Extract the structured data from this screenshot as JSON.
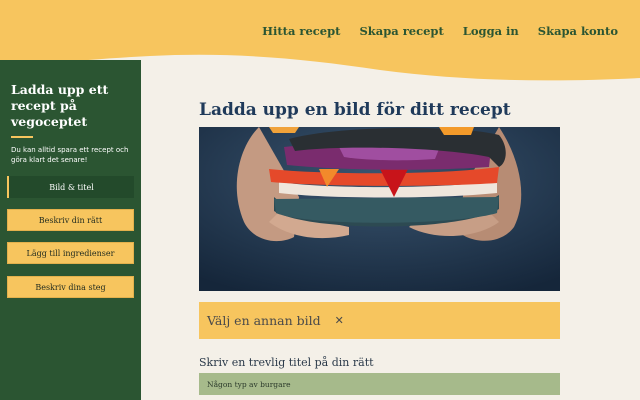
{
  "nav": {
    "find_recipe": "Hitta recept",
    "create_recipe": "Skapa recept",
    "login": "Logga in",
    "create_account": "Skapa konto"
  },
  "sidebar": {
    "title": "Ladda upp ett recept på vegoceptet",
    "note": "Du kan alltid spara ett recept och göra klart det senare!",
    "steps": [
      {
        "label": "Bild & titel",
        "state": "active"
      },
      {
        "label": "Beskriv din rätt",
        "state": "todo"
      },
      {
        "label": "Lägg till ingredienser",
        "state": "todo"
      },
      {
        "label": "Beskriv dina steg",
        "state": "todo"
      }
    ]
  },
  "main": {
    "title": "Ladda upp en bild för ditt recept",
    "change_image_label": "Välj en annan bild",
    "change_image_icon": "close-icon",
    "field_label": "Skriv en trevlig titel på din rätt",
    "title_placeholder": "Någon typ av burgare"
  },
  "colors": {
    "header_yellow": "#f7c55e",
    "sidebar_green": "#2b5532",
    "background": "#f4f0e8",
    "input_green": "#a6ba8b",
    "title_blue": "#1f3a5a"
  }
}
